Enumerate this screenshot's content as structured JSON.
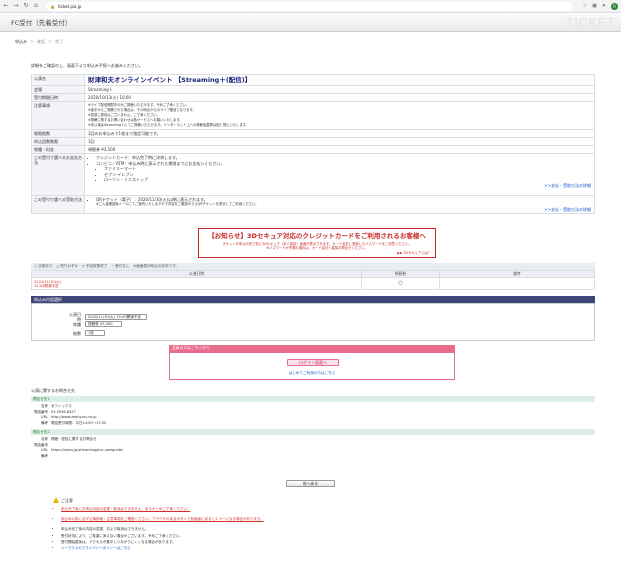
{
  "browser": {
    "url": "ticket.pia.jp",
    "back": "←",
    "forward": "→",
    "reload": "↻",
    "home": "⌂",
    "profile_initial": "R"
  },
  "header": {
    "title": "FC受付（先着受付）",
    "logo": "TICKET"
  },
  "steps": [
    "申込み",
    "確認",
    "完了"
  ],
  "intro": "詳細をご確認の上、画面下より申込み手続へお進みください。",
  "event": {
    "rows": [
      {
        "label": "公演名",
        "value": "財津和夫オンラインイベント 【Streaming＋(配信)】",
        "style": "title"
      },
      {
        "label": "会場",
        "value": "Streaming＋"
      },
      {
        "label": "受付期間日時",
        "value": "2020/10/13(火) 10:00"
      },
      {
        "label": "注意事項",
        "lines": [
          "※ライブ配信期間中のみご視聴いただけます。予めご了承ください。",
          "※途中からご視聴された場合は、その時点からのライブ配信となります。",
          "※見逃し配信はございません。ご了承ください。",
          "※視聴に関するお問い合わせは各サービスへお願いいたします。",
          "※本公演はStreaming＋にてご視聴いただけます。インターネット上への無断転載等は固く禁止いたします。"
        ]
      },
      {
        "label": "制限枚数",
        "value": "1回のお申込みで1枚まで指定可能です。"
      },
      {
        "label": "申込回数制限",
        "value": "1回"
      },
      {
        "label": "席種・料金",
        "value": "視聴券 ¥3,500"
      },
      {
        "label": "この受付で選べるお支払方法",
        "pay_items": [
          "クレジットカード：申込完了時に決済します。",
          "コンビニ／ATM：申込み時に表示された期限までにお支払いください。"
        ],
        "stores": [
          "ファミリーマート",
          "セブン-イレブン",
          "ローソン・ミニストップ"
        ],
        "link": ">>支払・受取方法の詳細"
      },
      {
        "label": "この受付で選べる受取方法",
        "pick_items": [
          "QRチケット（電子）：2020/11/10(火)以降に表示されます。"
        ],
        "note": "※ご入金確認後メールにてご案内いたしますので内容をご確認のうえQRチケットを表示してご利用ください。",
        "link": ">>支払・受取方法の詳細"
      }
    ]
  },
  "notice": {
    "heading": "【お知らせ】3Dセキュア対応のクレジットカードをご利用されるお客様へ",
    "body1": "チケットお申込み完了前に3Dセキュア（本人認証）画面が表示されます。カード会社に登録したパスワードをご用意ください。",
    "body2": "※パスワードが不明の場合は、カード会社へ直接お問合せください。",
    "link": "▶▶ 3Dセキュアとは？"
  },
  "schedule": {
    "legend": "○ 空席あり　△ 残りわずか　× 予定枚数終了　− 受付なし　※画面表示時点の状況です。",
    "headers": [
      "公演日時",
      "視聴券",
      "備考"
    ],
    "rows": [
      {
        "date": "2020/11/10(火)",
        "time": "15:00開演予定",
        "status": "○",
        "note": ""
      }
    ]
  },
  "selection": {
    "title": "申込み内容選択",
    "fields": [
      {
        "label": "公演日時",
        "value": "2020/11/10(火) 15:00開演予定"
      },
      {
        "label": "席種",
        "value": "視聴券 ¥3,500"
      },
      {
        "label": "枚数",
        "value": "1枚"
      }
    ]
  },
  "login": {
    "header": "会員の方はこちらから",
    "button": "ログイン画面へ",
    "link": "はじめてご利用の方はこちら"
  },
  "venue": {
    "heading": "公演に関するお問合せ先",
    "blocks": [
      {
        "head": "問合せ先1",
        "rows": [
          {
            "k": "名称",
            "v": "ゼフィックス"
          },
          {
            "k": "電話番号",
            "v": "03-5938-8427"
          },
          {
            "k": "URL",
            "v": "http://www.zephyrus.co.jp"
          },
          {
            "k": "備考",
            "v": "電話受付時間：平日14:00〜17:00"
          }
        ]
      },
      {
        "head": "問合せ先2",
        "rows": [
          {
            "k": "名称",
            "v": "視聴・配信に関するお問合せ"
          },
          {
            "k": "電話番号",
            "v": ""
          },
          {
            "k": "URL",
            "v": "https://eplus.jp/streamingplus-userguide/"
          },
          {
            "k": "備考",
            "v": ""
          }
        ]
      }
    ]
  },
  "back_button": "前へ戻る",
  "notes": {
    "heading": "ご注意",
    "items": [
      {
        "text": "申込完了後にお申込内容の変更・取消はできません。あらかじめご了承ください。",
        "style": "red"
      },
      {
        "text": "申込みの前に必ず公演詳細・注意事項をご確認ください。ブラウザの戻るボタンで前画面に戻るとエラーになる場合があります。",
        "style": "red gap"
      },
      {
        "text": "申込み完了後の内容の変更、および取消はできません。",
        "style": "gap"
      },
      {
        "text": "受付状況により、ご希望に添えない場合がございます。予めご了承ください。",
        "style": ""
      },
      {
        "text": "受付開始直後は、アクセスが集中しつながりにくくなる場合があります。",
        "style": ""
      },
      {
        "text": "イープラスのプライバシーポリシーはこちら",
        "style": "blue"
      }
    ]
  }
}
